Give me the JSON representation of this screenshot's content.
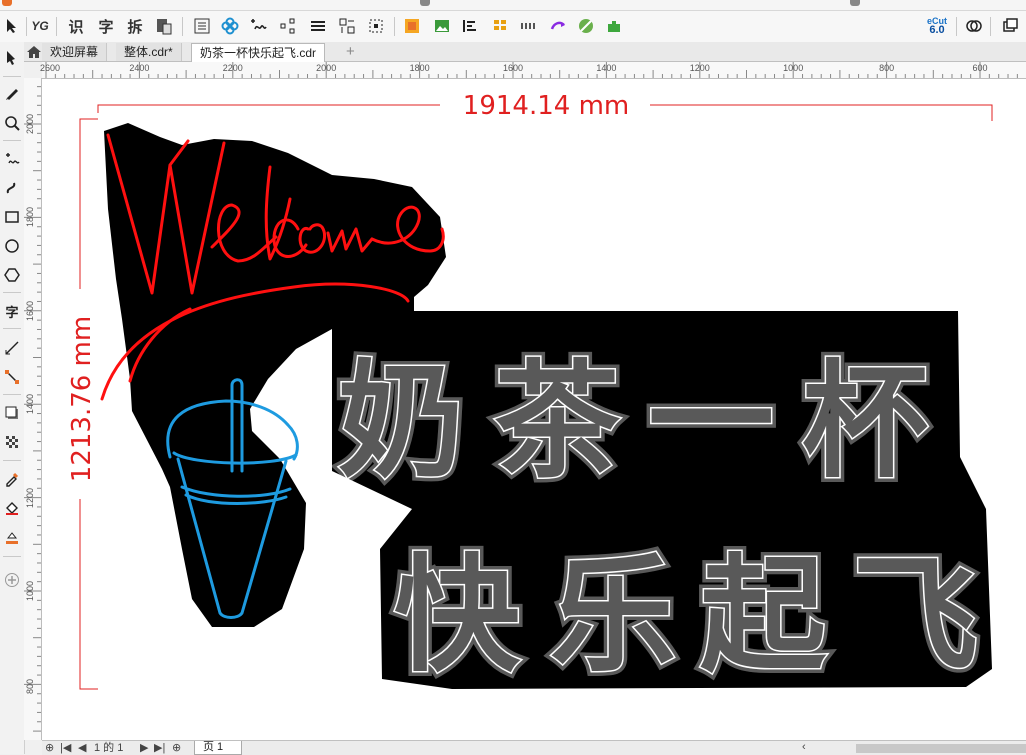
{
  "toolbar": {
    "app_icon": "yg-logo-icon",
    "text_buttons": [
      "识",
      "字",
      "拆"
    ],
    "ecut_label": "eCut",
    "ecut_version": "6.0"
  },
  "tabs": [
    {
      "label": "欢迎屏幕",
      "active": false
    },
    {
      "label": "整体.cdr*",
      "active": false
    },
    {
      "label": "奶茶一杯快乐起飞.cdr",
      "active": true
    }
  ],
  "tab_add_label": "+",
  "toolbox": {
    "text_tool_label": "字"
  },
  "rulers": {
    "horizontal": [
      "2600",
      "2400",
      "2200",
      "2000",
      "1800",
      "1600",
      "1400",
      "1200",
      "1000",
      "800",
      "600"
    ],
    "vertical": [
      "2000",
      "1800",
      "1600",
      "1400",
      "1200",
      "1000",
      "800"
    ]
  },
  "canvas": {
    "width_dimension": "1914.14 mm",
    "height_dimension": "1213.76 mm",
    "welcome_text": "Welcome",
    "line1": [
      "奶",
      "茶",
      "一",
      "杯"
    ],
    "line2": [
      "快",
      "乐",
      "起",
      "飞"
    ],
    "colors": {
      "dimension": "#e02020",
      "neon_red": "#ff1010",
      "neon_blue": "#1e9be0",
      "backing": "#000000",
      "outline": "#ffffff"
    }
  },
  "pagebar": {
    "page_count": "1 的 1",
    "page_tab": "页 1"
  }
}
